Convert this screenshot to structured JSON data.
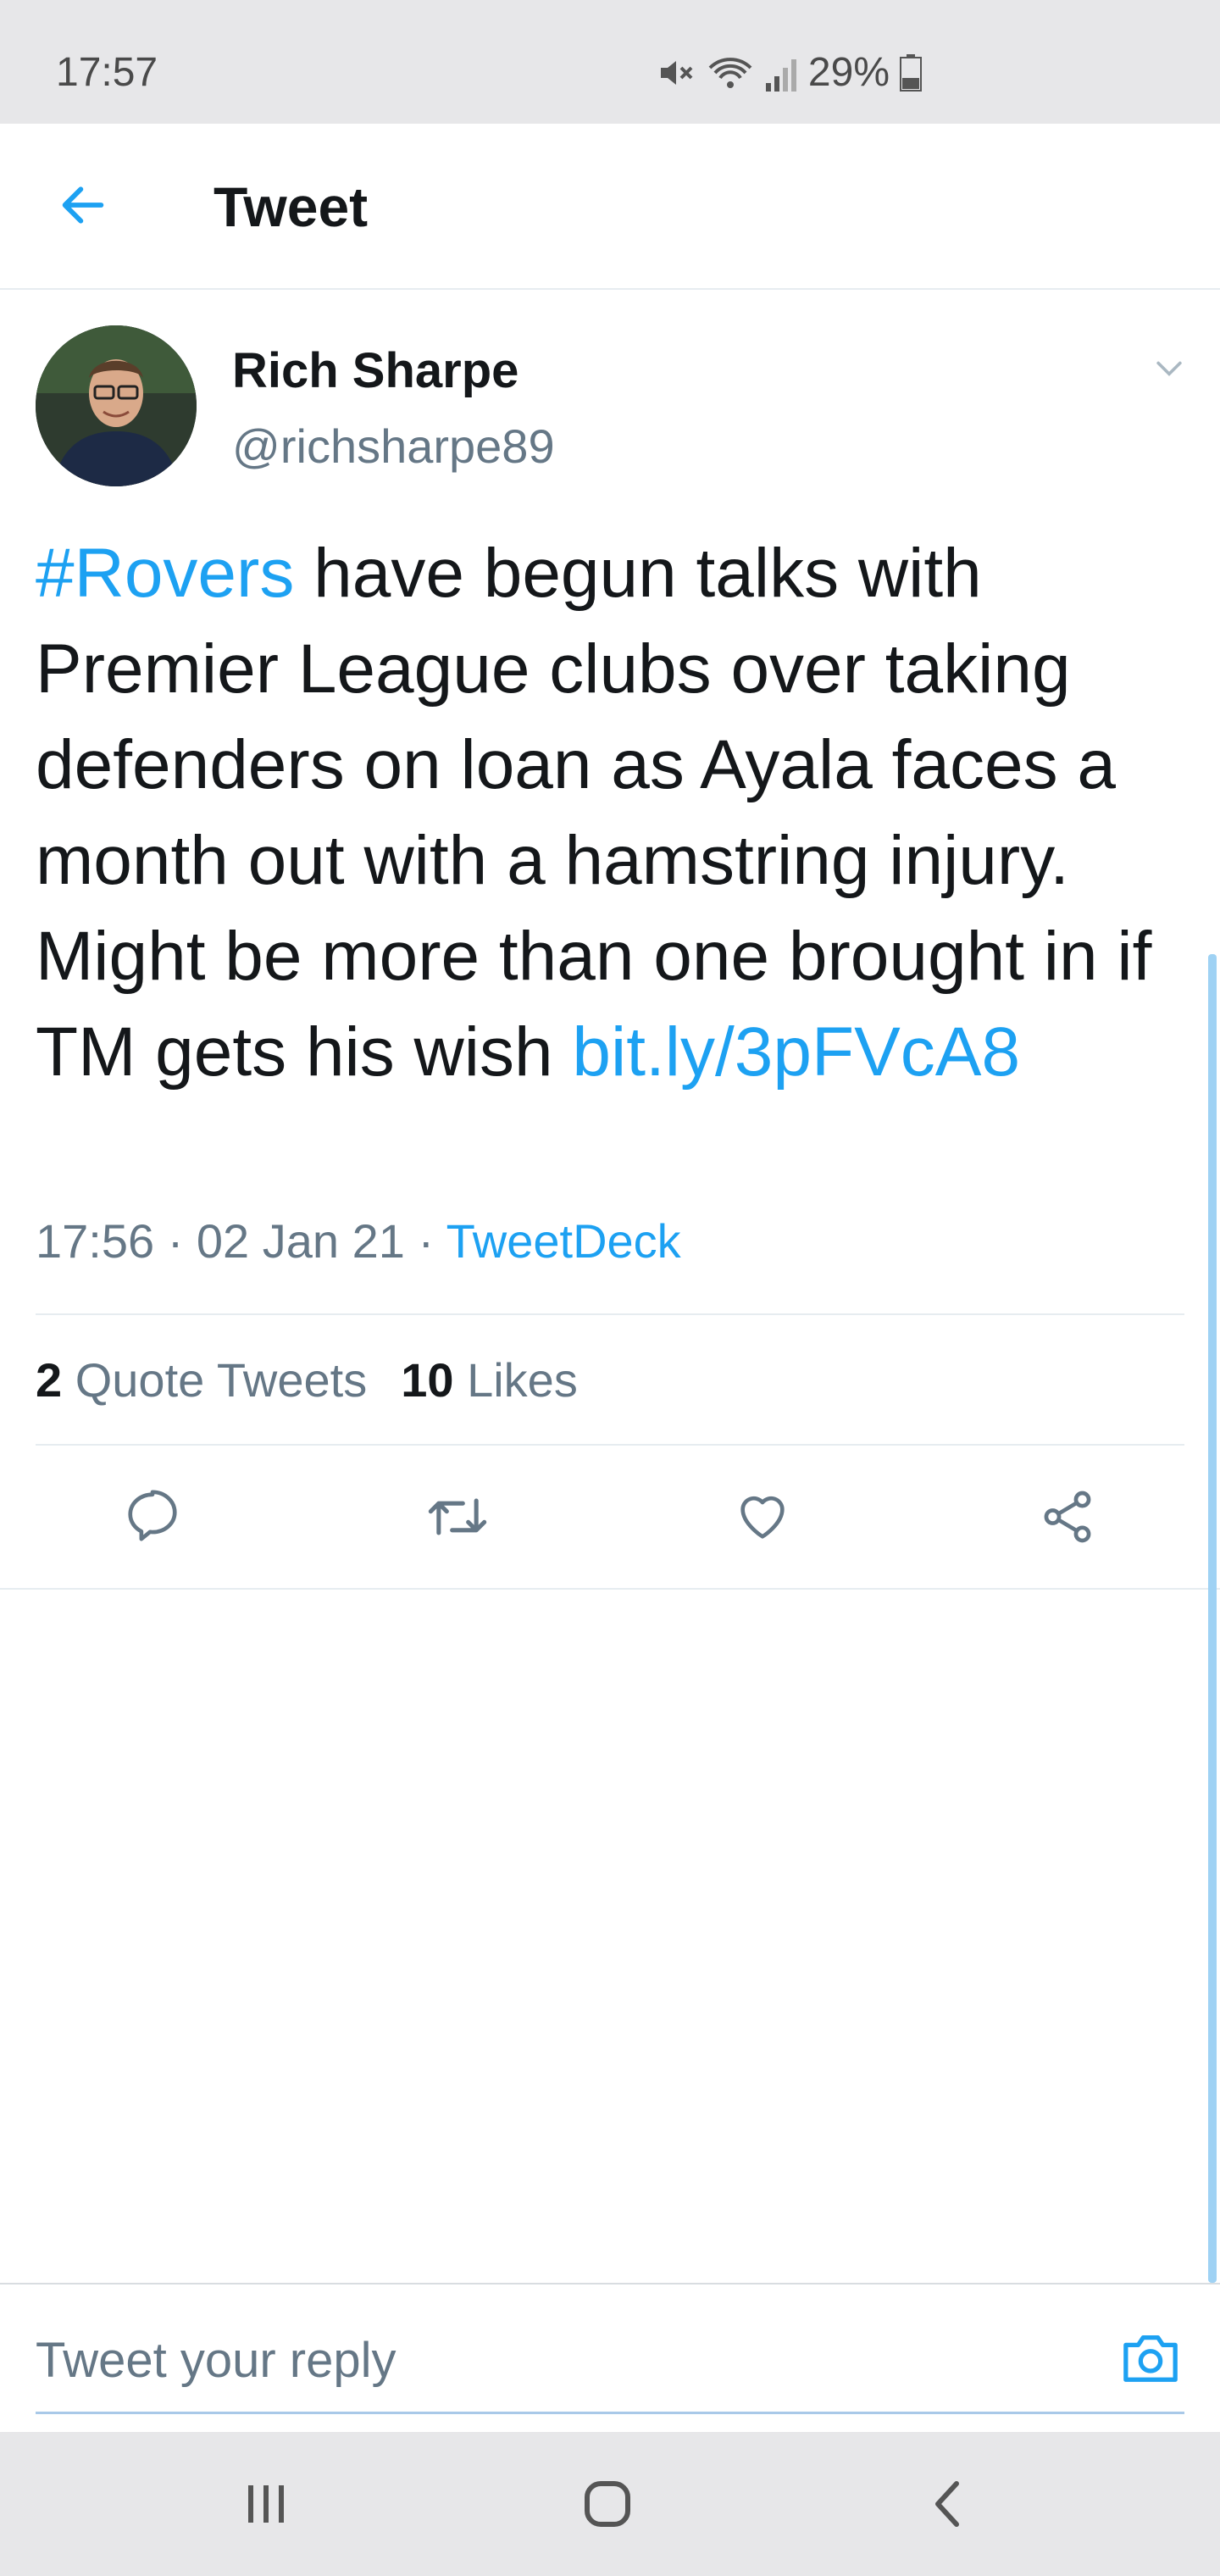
{
  "status_bar": {
    "time": "17:57",
    "battery_percent": "29%",
    "icons": [
      "mute-icon",
      "wifi-icon",
      "signal-icon",
      "battery-icon"
    ]
  },
  "header": {
    "title": "Tweet",
    "back_icon": "arrow-left-icon"
  },
  "tweet": {
    "author_name": "Rich Sharpe",
    "author_handle": "@richsharpe89",
    "hashtag": "#Rovers",
    "text": " have begun talks with Premier League clubs over taking defenders on loan as Ayala faces a month out with a hamstring injury. Might be more than one brought in if TM gets his wish ",
    "link": "bit.ly/3pFVcA8",
    "time": "17:56",
    "separator": " · ",
    "date": "02 Jan 21",
    "source": "TweetDeck"
  },
  "stats": {
    "quote_count": "2",
    "quote_label": "Quote Tweets",
    "like_count": "10",
    "like_label": "Likes"
  },
  "actions": [
    "reply-icon",
    "retweet-icon",
    "like-icon",
    "share-icon"
  ],
  "reply": {
    "placeholder": "Tweet your reply"
  },
  "colors": {
    "accent": "#1da1f2",
    "secondary_text": "#657786",
    "primary_text": "#14171a",
    "system_bar": "#e7e7e9"
  }
}
